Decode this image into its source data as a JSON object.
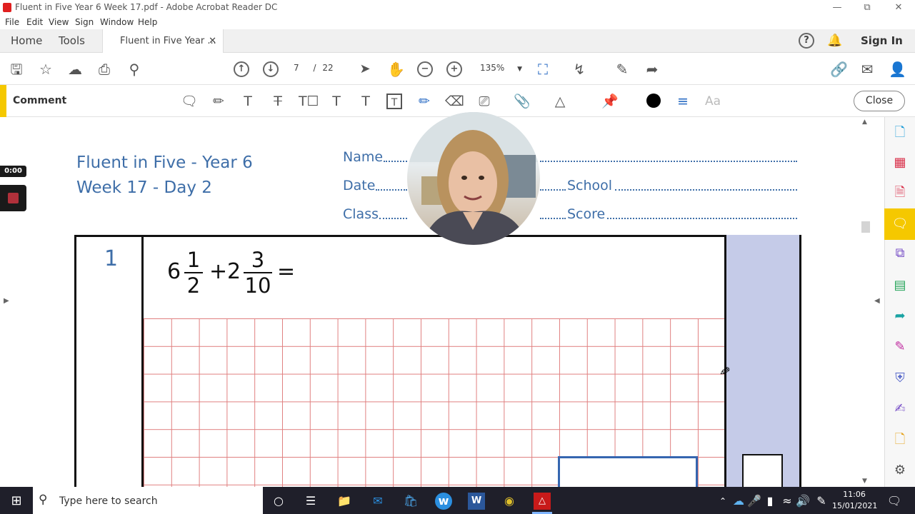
{
  "window": {
    "title": "Fluent in Five Year 6 Week 17.pdf - Adobe Acrobat Reader DC"
  },
  "menu": [
    "File",
    "Edit",
    "View",
    "Sign",
    "Window",
    "Help"
  ],
  "tabs": {
    "home": "Home",
    "tools": "Tools",
    "document": "Fluent in Five Year ..."
  },
  "header_right": {
    "sign_in": "Sign In"
  },
  "toolbar": {
    "page_current": "7",
    "page_sep": "/",
    "page_total": "22",
    "zoom": "135%"
  },
  "comment_bar": {
    "label": "Comment",
    "close": "Close",
    "font_label": "Aa"
  },
  "recorder": {
    "timer": "0:00"
  },
  "worksheet": {
    "title_line1": "Fluent in Five - Year 6",
    "title_line2": "Week 17 - Day 2",
    "name_label": "Name",
    "date_label": "Date",
    "school_label": "School",
    "class_label": "Class",
    "score_label": "Score",
    "question_number": "1",
    "question": {
      "whole1": "6",
      "num1": "1",
      "den1": "2",
      "op": "+",
      "whole2": "2",
      "num2": "3",
      "den2": "10",
      "eq": "="
    }
  },
  "taskbar": {
    "search_placeholder": "Type here to search",
    "time": "11:06",
    "date": "15/01/2021"
  },
  "colors": {
    "accent_yellow": "#f5c800",
    "worksheet_blue": "#3e6ea8",
    "mark_column": "#c5cbe8",
    "grid_red": "#e08080"
  }
}
